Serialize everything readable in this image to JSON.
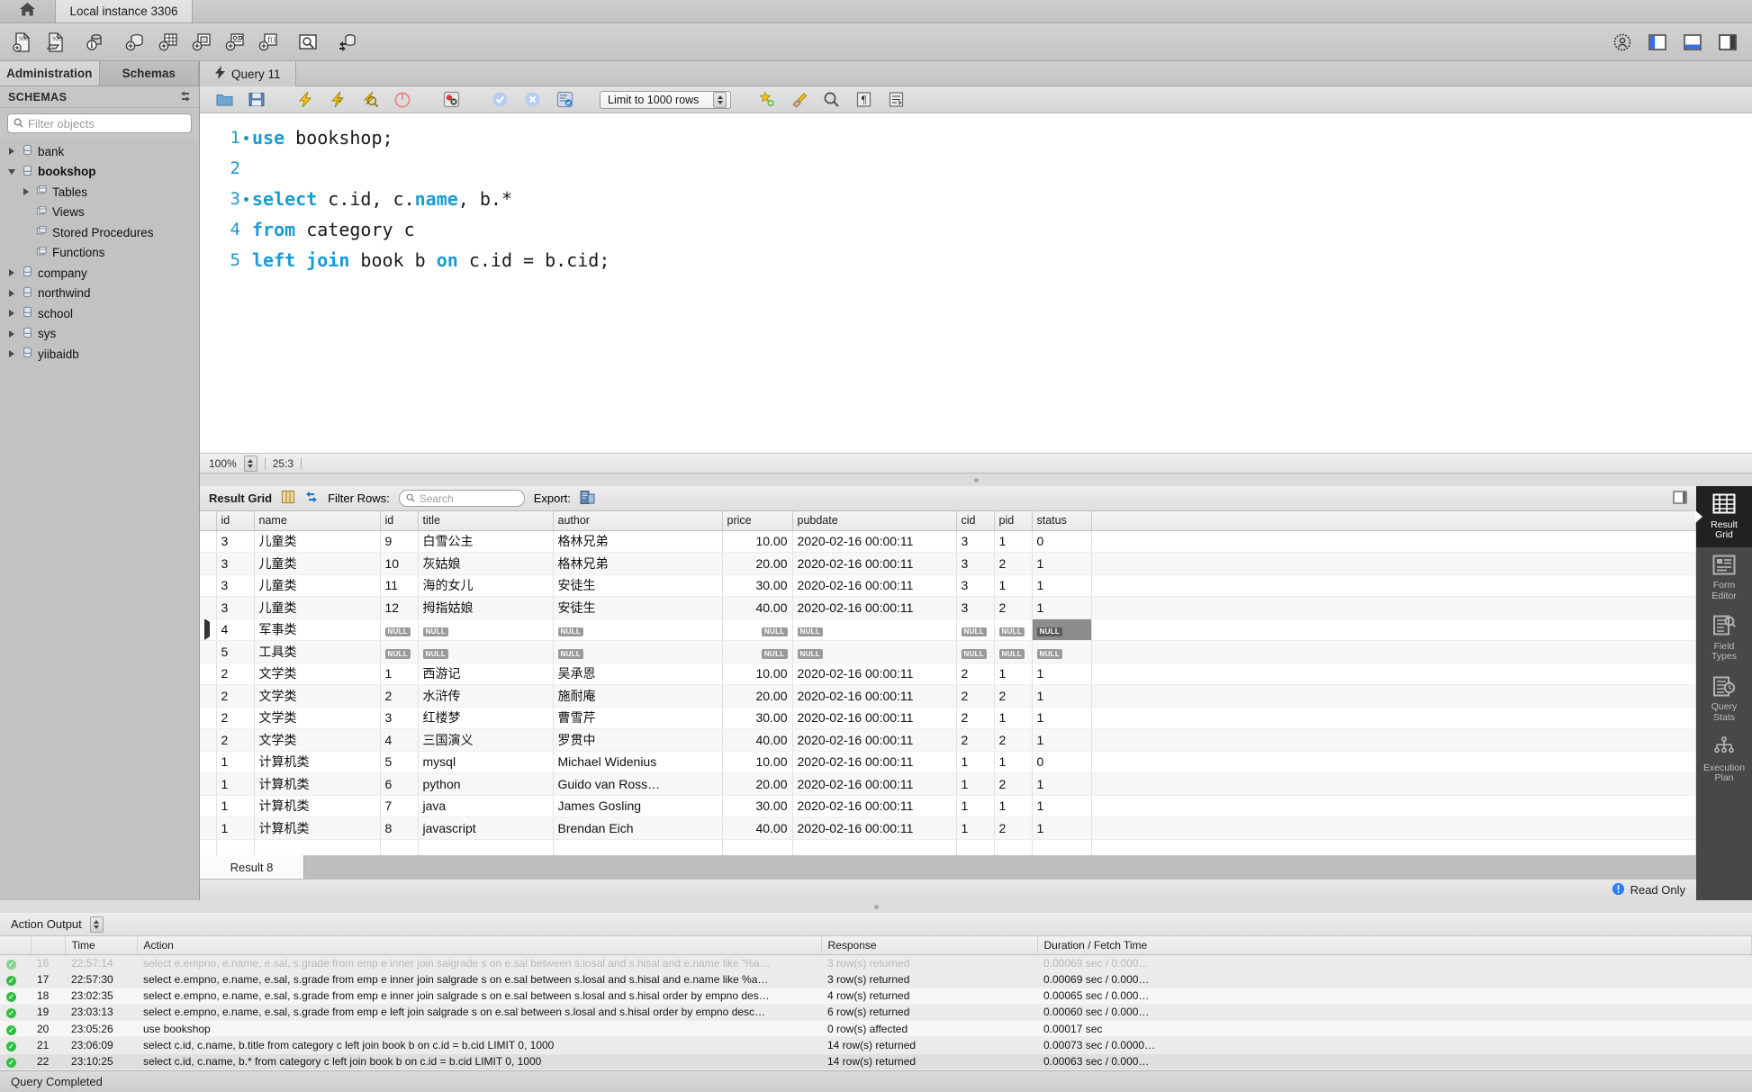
{
  "window": {
    "home_tab_icon": "home-icon",
    "instance_tab": "Local instance 3306",
    "status_text": "Query Completed"
  },
  "main_toolbar": {
    "icons": [
      "new-sql-tab-icon",
      "open-sql-script-icon",
      "connection-info-icon",
      "new-schema-icon",
      "new-table-icon",
      "new-view-icon",
      "new-procedure-icon",
      "new-function-icon",
      "search-data-icon",
      "reconnect-server-icon"
    ],
    "right_icons": [
      "help-icon",
      "toggle-sidebar-icon",
      "toggle-output-icon",
      "toggle-secondary-sidebar-icon"
    ]
  },
  "sidebar": {
    "tabs": [
      {
        "label": "Administration",
        "active": false
      },
      {
        "label": "Schemas",
        "active": true
      }
    ],
    "panel_title": "SCHEMAS",
    "refresh_icon": "refresh-icon",
    "filter": {
      "placeholder": "Filter objects",
      "value": "",
      "icon": "search-icon"
    },
    "tree": [
      {
        "label": "bank",
        "level": 0,
        "expanded": false,
        "bold": false,
        "icon": "schema-icon"
      },
      {
        "label": "bookshop",
        "level": 0,
        "expanded": true,
        "bold": true,
        "icon": "schema-icon"
      },
      {
        "label": "Tables",
        "level": 1,
        "expanded": false,
        "bold": false,
        "icon": "folder-icon"
      },
      {
        "label": "Views",
        "level": 1,
        "expanded": null,
        "bold": false,
        "icon": "folder-icon"
      },
      {
        "label": "Stored Procedures",
        "level": 1,
        "expanded": null,
        "bold": false,
        "icon": "folder-icon"
      },
      {
        "label": "Functions",
        "level": 1,
        "expanded": null,
        "bold": false,
        "icon": "folder-icon"
      },
      {
        "label": "company",
        "level": 0,
        "expanded": false,
        "bold": false,
        "icon": "schema-icon"
      },
      {
        "label": "northwind",
        "level": 0,
        "expanded": false,
        "bold": false,
        "icon": "schema-icon"
      },
      {
        "label": "school",
        "level": 0,
        "expanded": false,
        "bold": false,
        "icon": "schema-icon"
      },
      {
        "label": "sys",
        "level": 0,
        "expanded": false,
        "bold": false,
        "icon": "schema-icon"
      },
      {
        "label": "yiibaidb",
        "level": 0,
        "expanded": false,
        "bold": false,
        "icon": "schema-icon"
      }
    ]
  },
  "query_tab": {
    "label": "Query 11",
    "icon": "lightning-icon"
  },
  "sql_toolbar": {
    "icons": [
      "open-file-icon",
      "save-file-icon",
      "execute-icon",
      "execute-current-icon",
      "explain-icon",
      "stop-icon",
      "toggle-stop-on-error-icon",
      "commit-icon",
      "rollback-icon",
      "autocommit-icon"
    ],
    "limit_label": "Limit to 1000 rows",
    "right_icons": [
      "beautify-icon",
      "clear-icon",
      "find-icon",
      "invisible-chars-icon",
      "wrap-lines-icon"
    ]
  },
  "editor": {
    "lines": [
      {
        "num": "1",
        "exec_dot": true,
        "tokens": [
          {
            "t": "use",
            "kw": true
          },
          {
            "t": " bookshop;",
            "kw": false
          }
        ]
      },
      {
        "num": "2",
        "exec_dot": false,
        "tokens": []
      },
      {
        "num": "3",
        "exec_dot": true,
        "tokens": [
          {
            "t": "select",
            "kw": true
          },
          {
            "t": " c.id, c.",
            "kw": false
          },
          {
            "t": "name",
            "kw": true
          },
          {
            "t": ", b.*",
            "kw": false
          }
        ]
      },
      {
        "num": "4",
        "exec_dot": false,
        "tokens": [
          {
            "t": "from",
            "kw": true
          },
          {
            "t": " category c",
            "kw": false
          }
        ]
      },
      {
        "num": "5",
        "exec_dot": false,
        "tokens": [
          {
            "t": "left join",
            "kw": true
          },
          {
            "t": " book b ",
            "kw": false
          },
          {
            "t": "on",
            "kw": true
          },
          {
            "t": " c.id = b.cid;",
            "kw": false
          }
        ]
      }
    ],
    "zoom": "100%",
    "cursor_position": "25:3"
  },
  "result_grid": {
    "title": "Result Grid",
    "grid_icon": "grid-view-icon",
    "wrap_icon": "wrap-cell-icon",
    "filter_label": "Filter Rows:",
    "search_placeholder": "Search",
    "search_value": "",
    "export_label": "Export:",
    "export_icon": "export-icon",
    "maximize_icon": "maximize-panel-icon",
    "columns": [
      "id",
      "name",
      "id",
      "title",
      "author",
      "price",
      "pubdate",
      "cid",
      "pid",
      "status"
    ],
    "rows": [
      {
        "marker": "",
        "cells": [
          "3",
          "儿童类",
          "9",
          "白雪公主",
          "格林兄弟",
          "10.00",
          "2020-02-16 00:00:11",
          "3",
          "1",
          "0"
        ]
      },
      {
        "marker": "",
        "cells": [
          "3",
          "儿童类",
          "10",
          "灰姑娘",
          "格林兄弟",
          "20.00",
          "2020-02-16 00:00:11",
          "3",
          "2",
          "1"
        ]
      },
      {
        "marker": "",
        "cells": [
          "3",
          "儿童类",
          "11",
          "海的女儿",
          "安徒生",
          "30.00",
          "2020-02-16 00:00:11",
          "3",
          "1",
          "1"
        ]
      },
      {
        "marker": "",
        "cells": [
          "3",
          "儿童类",
          "12",
          "拇指姑娘",
          "安徒生",
          "40.00",
          "2020-02-16 00:00:11",
          "3",
          "2",
          "1"
        ]
      },
      {
        "marker": "▶",
        "cells": [
          "4",
          "军事类",
          "NULL",
          "NULL",
          "NULL",
          "NULL",
          "NULL",
          "NULL",
          "NULL",
          "NULL"
        ],
        "selected_cell": 9
      },
      {
        "marker": "",
        "cells": [
          "5",
          "工具类",
          "NULL",
          "NULL",
          "NULL",
          "NULL",
          "NULL",
          "NULL",
          "NULL",
          "NULL"
        ]
      },
      {
        "marker": "",
        "cells": [
          "2",
          "文学类",
          "1",
          "西游记",
          "吴承恩",
          "10.00",
          "2020-02-16 00:00:11",
          "2",
          "1",
          "1"
        ]
      },
      {
        "marker": "",
        "cells": [
          "2",
          "文学类",
          "2",
          "水浒传",
          "施耐庵",
          "20.00",
          "2020-02-16 00:00:11",
          "2",
          "2",
          "1"
        ]
      },
      {
        "marker": "",
        "cells": [
          "2",
          "文学类",
          "3",
          "红楼梦",
          "曹雪芹",
          "30.00",
          "2020-02-16 00:00:11",
          "2",
          "1",
          "1"
        ]
      },
      {
        "marker": "",
        "cells": [
          "2",
          "文学类",
          "4",
          "三国演义",
          "罗贯中",
          "40.00",
          "2020-02-16 00:00:11",
          "2",
          "2",
          "1"
        ]
      },
      {
        "marker": "",
        "cells": [
          "1",
          "计算机类",
          "5",
          "mysql",
          "Michael Widenius",
          "10.00",
          "2020-02-16 00:00:11",
          "1",
          "1",
          "0"
        ]
      },
      {
        "marker": "",
        "cells": [
          "1",
          "计算机类",
          "6",
          "python",
          "Guido van Ross…",
          "20.00",
          "2020-02-16 00:00:11",
          "1",
          "2",
          "1"
        ]
      },
      {
        "marker": "",
        "cells": [
          "1",
          "计算机类",
          "7",
          "java",
          "James Gosling",
          "30.00",
          "2020-02-16 00:00:11",
          "1",
          "1",
          "1"
        ]
      },
      {
        "marker": "",
        "cells": [
          "1",
          "计算机类",
          "8",
          "javascript",
          "Brendan Eich",
          "40.00",
          "2020-02-16 00:00:11",
          "1",
          "2",
          "1"
        ]
      }
    ],
    "result_tab": "Result 8",
    "read_only": "Read Only",
    "read_only_icon": "info-icon"
  },
  "right_rail": [
    {
      "label": "Result\nGrid",
      "icon": "result-grid-icon",
      "active": true
    },
    {
      "label": "Form\nEditor",
      "icon": "form-editor-icon",
      "active": false
    },
    {
      "label": "Field\nTypes",
      "icon": "field-types-icon",
      "active": false
    },
    {
      "label": "Query\nStats",
      "icon": "query-stats-icon",
      "active": false
    },
    {
      "label": "Execution\nPlan",
      "icon": "execution-plan-icon",
      "active": false
    }
  ],
  "action_output": {
    "title": "Action Output",
    "dropdown_icon": "stepper-icon",
    "columns": [
      "",
      "Time",
      "Action",
      "Response",
      "Duration / Fetch Time"
    ],
    "rows": [
      {
        "status": "ok",
        "n": "16",
        "time": "22:57:14",
        "action": "select e.empno, e.name, e.sal, s.grade from emp e inner join salgrade s on e.sal between s.losal and s.hisal and e.name like '%a…",
        "response": "3 row(s) returned",
        "duration": "0.00069 sec / 0.000…",
        "clipped": true
      },
      {
        "status": "ok",
        "n": "17",
        "time": "22:57:30",
        "action": "select e.empno, e.name, e.sal, s.grade from emp e inner join salgrade s on e.sal between s.losal and s.hisal and e.name like %a…",
        "response": "3 row(s) returned",
        "duration": "0.00069 sec / 0.000…"
      },
      {
        "status": "ok",
        "n": "18",
        "time": "23:02:35",
        "action": "select e.empno, e.name, e.sal, s.grade from emp e inner join salgrade s on e.sal between s.losal and s.hisal  order by empno des…",
        "response": "4 row(s) returned",
        "duration": "0.00065 sec / 0.000…"
      },
      {
        "status": "ok",
        "n": "19",
        "time": "23:03:13",
        "action": "select e.empno, e.name, e.sal, s.grade from emp e left join salgrade s on e.sal between s.losal and s.hisal  order by empno desc…",
        "response": "6 row(s) returned",
        "duration": "0.00060 sec / 0.000…"
      },
      {
        "status": "ok",
        "n": "20",
        "time": "23:05:26",
        "action": "use bookshop",
        "response": "0 row(s) affected",
        "duration": "0.00017 sec"
      },
      {
        "status": "ok",
        "n": "21",
        "time": "23:06:09",
        "action": "select c.id, c.name, b.title from category c left join book b on c.id = b.cid LIMIT 0, 1000",
        "response": "14 row(s) returned",
        "duration": "0.00073 sec / 0.0000…"
      },
      {
        "status": "ok",
        "n": "22",
        "time": "23:10:25",
        "action": "select c.id, c.name, b.* from category c left join book b on c.id = b.cid LIMIT 0, 1000",
        "response": "14 row(s) returned",
        "duration": "0.00063 sec / 0.000…",
        "selected": true
      }
    ]
  },
  "colors": {
    "keyword_blue": "#1a9bd7",
    "rail_active_bg": "#212121",
    "rail_bg": "#484848",
    "ok_green": "#2fbf3f",
    "accent_blue": "#2d7ff9"
  }
}
